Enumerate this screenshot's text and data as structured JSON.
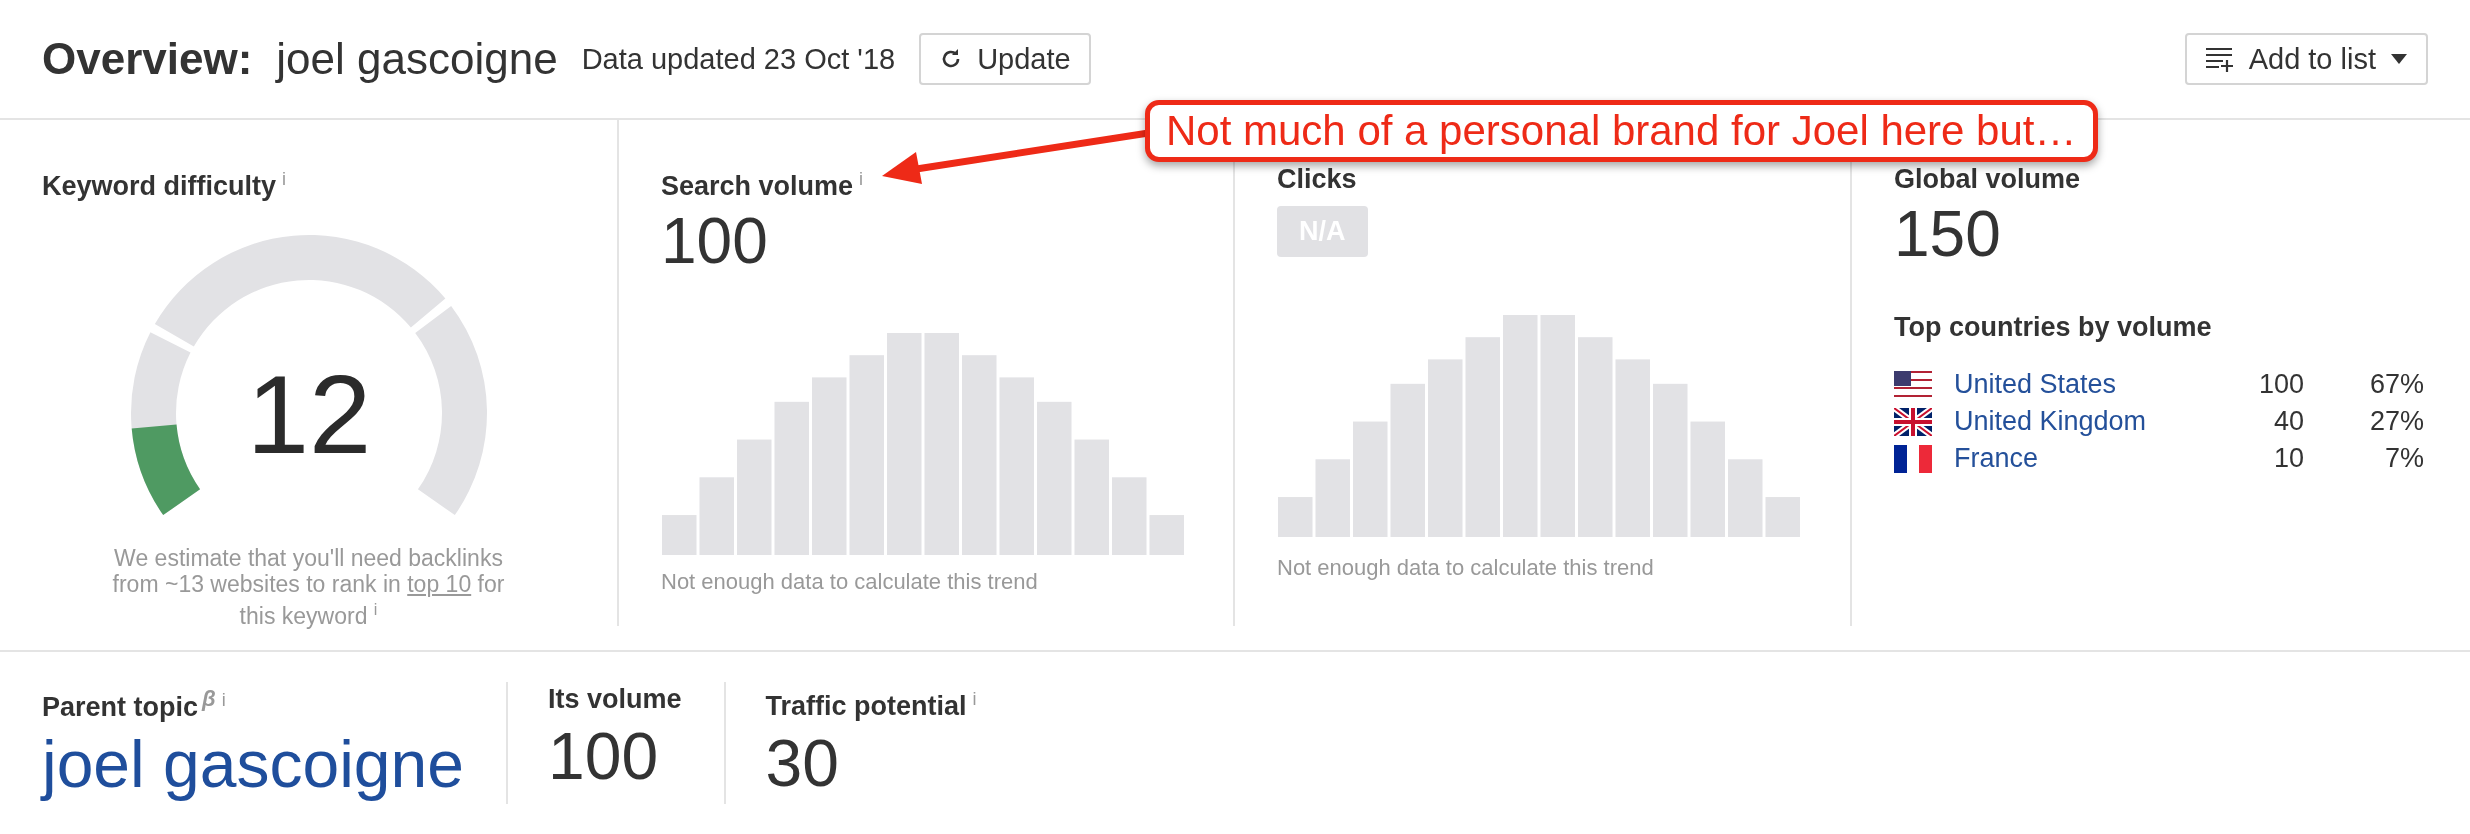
{
  "header": {
    "title": "Overview:",
    "keyword": "joel gascoigne",
    "updated": "Data updated 23 Oct '18",
    "update_button": "Update",
    "add_button": "Add to list"
  },
  "keyword_difficulty": {
    "title": "Keyword difficulty",
    "info": "i",
    "score": "12",
    "level": 0.12,
    "note": {
      "before": "We estimate that you'll need backlinks from ~13 websites to rank in ",
      "link": "top 10",
      "after": " for this keyword",
      "info": "i"
    }
  },
  "search_volume": {
    "title": "Search volume",
    "info": "i",
    "value": "100",
    "trend_note": "Not enough data to calculate this trend"
  },
  "clicks": {
    "title": "Clicks",
    "badge": "N/A",
    "trend_note": "Not enough data to calculate this trend"
  },
  "global_volume": {
    "title": "Global volume",
    "value": "150",
    "countries_title": "Top countries by volume",
    "countries": [
      {
        "name": "United States",
        "volume": "100",
        "share": "67%"
      },
      {
        "name": "United Kingdom",
        "volume": "40",
        "share": "27%"
      },
      {
        "name": "France",
        "volume": "10",
        "share": "7%"
      }
    ]
  },
  "parent_topic": {
    "title": "Parent topic",
    "badge": "β",
    "info": "i",
    "value": "joel gascoigne"
  },
  "its_volume": {
    "title": "Its volume",
    "value": "100"
  },
  "traffic_potential": {
    "title": "Traffic potential",
    "info": "i",
    "value": "30"
  },
  "callout": {
    "text": "Not much of a personal brand for Joel here but…"
  }
}
